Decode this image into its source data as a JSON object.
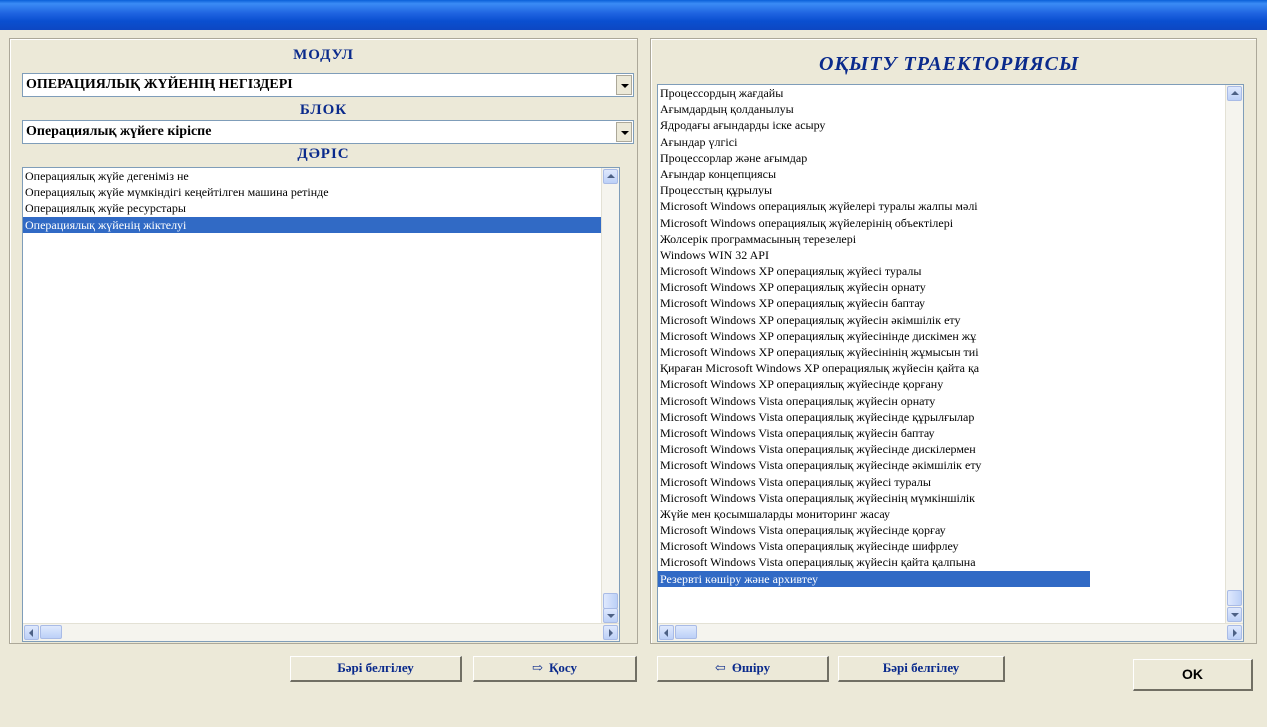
{
  "module": {
    "label": "МОДУЛ",
    "value": "ОПЕРАЦИЯЛЫҚ ЖҮЙЕНІҢ НЕГІЗДЕРІ"
  },
  "block": {
    "label": "БЛОК",
    "value": "Операциялық жүйеге кіріспе"
  },
  "lecture": {
    "label": "ДӘРІС",
    "items": [
      "Операциялық жүйе дегеніміз не",
      "Операциялық жүйе  мүмкіндігі кеңейтілген машина ретінде",
      "Операциялық жүйе ресурстары",
      "Операциялық жүйенің жіктелуі"
    ],
    "selected_index": 3
  },
  "trajectory": {
    "title": "ОҚЫТУ ТРАЕКТОРИЯСЫ",
    "items": [
      "Процессордың жағдайы",
      "Ағымдардың қолданылуы",
      "Ядродағы ағындарды іске асыру",
      "Ағындар үлгісі",
      "Процессорлар және ағымдар",
      "Ағындар концепциясы",
      "Процесстың құрылуы",
      "Microsoft Windows операциялық жүйелері туралы жалпы мәлі",
      "Microsoft Windows операциялық жүйелерінің объектілері",
      "Жолсерік программасының терезелері",
      "Windows WIN 32 API",
      "Microsoft Windows XP операциялық жүйесі туралы",
      "Microsoft Windows XP операциялық жүйесін орнату",
      "Microsoft Windows XP операциялық жүйесін баптау",
      "Microsoft Windows XP операциялық жүйесін әкімшілік ету",
      "Microsoft Windows XP операциялық жүйесінінде дискімен жұ",
      "Microsoft Windows XP операциялық жүйесінінің жұмысын тиі",
      "Қираған Microsoft Windows XP операциялық жүйесін қайта қа",
      "Microsoft Windows XP операциялық жүйесінде  қорғану",
      "Microsoft Windows Vista  операциялық жүйесін орнату",
      "Microsoft Windows Vista  операциялық жүйесінде құрылғылар",
      "Microsoft Windows Vista операциялық жүйесін баптау",
      "Microsoft Windows Vista операциялық жүйесінде дискілермен",
      "Microsoft Windows Vista операциялық жүйесінде әкімшілік ету",
      "Microsoft Windows Vista  операциялық жүйесі туралы",
      "Microsoft Windows Vista  операциялық жүйесінің мүмкіншілік",
      "Жүйе мен қосымшаларды мониторинг жасау",
      "Microsoft Windows Vista операциялық жүйесінде қорғау",
      "Microsoft Windows Vista операциялық жүйесінде шифрлеу",
      "Microsoft Windows Vista  операциялық жүйесін қайта қалпына",
      "Резервті көшіру және архивтеу"
    ],
    "selected_index": 30
  },
  "buttons": {
    "select_all_left": "Бәрі белгілеу",
    "add": "Қосу",
    "remove": "Өшіру",
    "select_all_right": "Бәрі белгілеу",
    "ok": "OK"
  },
  "icons": {
    "add": "arrow-right-icon",
    "remove": "arrow-left-icon"
  }
}
